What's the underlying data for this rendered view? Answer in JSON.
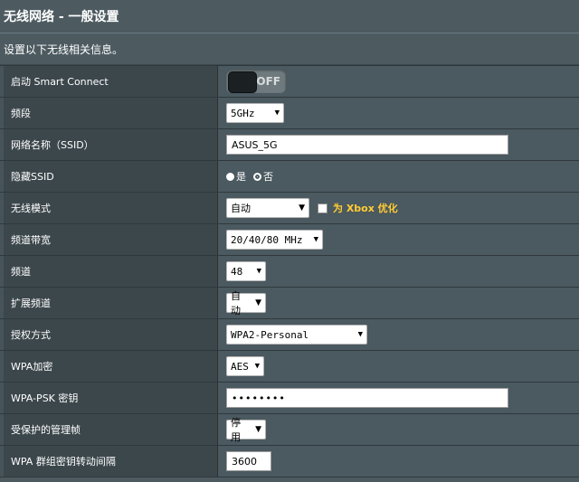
{
  "page": {
    "title": "无线网络 - 一般设置",
    "description": "设置以下无线相关信息。"
  },
  "settings": {
    "smart_connect": {
      "label": "启动 Smart Connect",
      "state": "OFF"
    },
    "band": {
      "label": "频段",
      "value": "5GHz"
    },
    "ssid": {
      "label": "网络名称（SSID）",
      "value": "ASUS_5G"
    },
    "hide_ssid": {
      "label": "隐藏SSID",
      "option_yes": "是",
      "option_no": "否",
      "selected": "否"
    },
    "wireless_mode": {
      "label": "无线模式",
      "value": "自动",
      "xbox_label": "为 Xbox 优化",
      "xbox_checked": false
    },
    "channel_bandwidth": {
      "label": "频道带宽",
      "value": "20/40/80 MHz"
    },
    "channel": {
      "label": "频道",
      "value": "48"
    },
    "extension_channel": {
      "label": "扩展频道",
      "value": "自动"
    },
    "auth_method": {
      "label": "授权方式",
      "value": "WPA2-Personal"
    },
    "wpa_encryption": {
      "label": "WPA加密",
      "value": "AES"
    },
    "wpa_psk": {
      "label": "WPA-PSK 密钥",
      "value": "••••••••"
    },
    "pmf": {
      "label": "受保护的管理帧",
      "value": "停用"
    },
    "group_key_interval": {
      "label": "WPA 群组密钥转动间隔",
      "value": "3600"
    }
  },
  "colors": {
    "background": "#4d5b61",
    "label_column": "#3c474c",
    "value_column": "#4b5960",
    "accent": "#ffcc33"
  }
}
